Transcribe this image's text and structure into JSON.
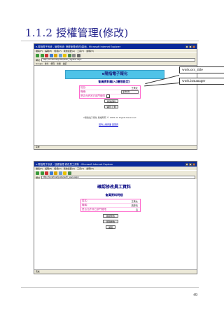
{
  "page": {
    "heading": "1.1.2 授權管理(修改)",
    "page_number": "49"
  },
  "browser": {
    "title1": "e-陽指電子系統 - 管理系統: 授權管理(修改)頁面 - Microsoft Internet Explorer",
    "title2": "e-陽指電子系統 - 授權管理 修改員工資料 - Microsoft Internet Explorer",
    "menu": [
      "檔案(F)",
      "編輯(E)",
      "檢視(V)",
      "我的最愛(A)",
      "工具(T)",
      "說明(H)"
    ],
    "address_label": "網址",
    "address1": "http://localhost/pubs/auth_register.aspx",
    "address2": "http://localhost/pubs/auth_save.aspx",
    "links": [
      "Google",
      "搜尋",
      "網頁",
      "新聞",
      "連結"
    ],
    "status": "完成"
  },
  "shot1": {
    "banner": "e陽指電子報化",
    "subtitle": "會員資料輸入(權限設定)",
    "rows": [
      {
        "label": "姓名:",
        "value": "王美女"
      },
      {
        "label": "職稱:",
        "input": "業務經理"
      },
      {
        "label": "是否允許其它部門權限",
        "checkbox": true
      }
    ],
    "btn_modify": "修改資料",
    "btn_back": "返回 上頁",
    "footer": "e陽指電子報化 版權所有 © 2005 All Rights Reserved",
    "footer_link": "回到上層頁面 回首頁"
  },
  "shot2": {
    "banner": "確認修改員工資料",
    "subtitle": "會員資料明細",
    "rows": [
      {
        "label": "姓名:",
        "value": "王美女"
      },
      {
        "label": "職稱:",
        "value": "講師長"
      },
      {
        "label": "是否允許其它部門權限",
        "value": "否"
      }
    ],
    "btn_confirm": "確認修改",
    "btn_again": "回到修改",
    "btn_back": "返回"
  },
  "callouts": {
    "occ_title": "work.occ_title",
    "ismanager": "work.ismanager"
  }
}
